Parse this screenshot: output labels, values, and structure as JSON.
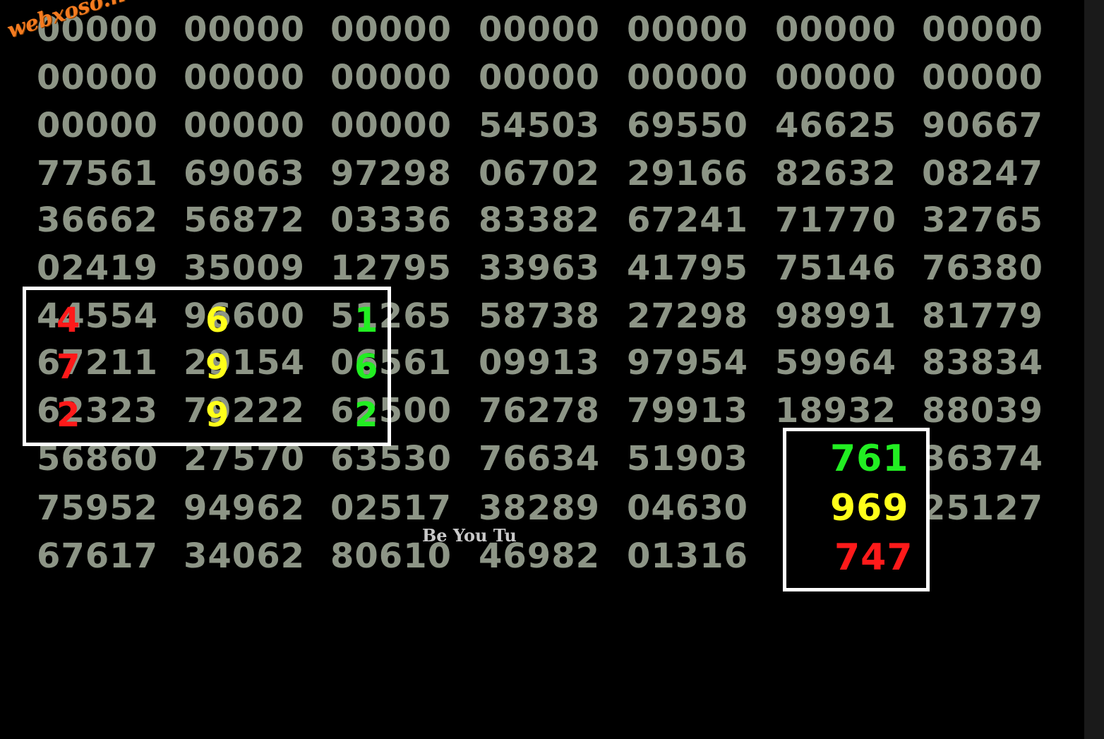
{
  "watermark": "webxoso.net",
  "credit": "Be You Tu",
  "colors": {
    "grid_text": "#8d9586",
    "red": "#ff1a1a",
    "yellow": "#ffff1a",
    "green": "#22ee22",
    "box_border": "#ffffff",
    "background": "#000000"
  },
  "grid": {
    "rows": [
      [
        "00000",
        "00000",
        "00000",
        "00000",
        "00000",
        "00000",
        "00000"
      ],
      [
        "00000",
        "00000",
        "00000",
        "00000",
        "00000",
        "00000",
        "00000"
      ],
      [
        "00000",
        "00000",
        "00000",
        "54503",
        "69550",
        "46625",
        "90667"
      ],
      [
        "77561",
        "69063",
        "97298",
        "06702",
        "29166",
        "82632",
        "08247"
      ],
      [
        "36662",
        "56872",
        "03336",
        "83382",
        "67241",
        "71770",
        "32765"
      ],
      [
        "02419",
        "35009",
        "12795",
        "33963",
        "41795",
        "75146",
        "76380"
      ],
      [
        "44554",
        "96600",
        "51265",
        "58738",
        "27298",
        "98991",
        "81779"
      ],
      [
        "67211",
        "29154",
        "06561",
        "09913",
        "97954",
        "59964",
        "83834"
      ],
      [
        "62323",
        "79222",
        "62500",
        "76278",
        "79913",
        "18932",
        "88039"
      ],
      [
        "56860",
        "27570",
        "63530",
        "76634",
        "51903",
        "",
        "36374"
      ],
      [
        "75952",
        "94962",
        "02517",
        "38289",
        "04630",
        "",
        "25127"
      ],
      [
        "67617",
        "34062",
        "80610",
        "46982",
        "01316",
        "",
        ""
      ]
    ]
  },
  "highlights": {
    "red_digits": [
      "4",
      "7",
      "2"
    ],
    "yellow_digits": [
      "6",
      "9",
      "9"
    ],
    "green_digits": [
      "1",
      "6",
      "2"
    ]
  },
  "result_box": {
    "lines": [
      {
        "text": "761",
        "color": "#22ee22"
      },
      {
        "text": "969",
        "color": "#ffff1a"
      },
      {
        "text": "747",
        "color": "#ff1a1a"
      }
    ]
  }
}
